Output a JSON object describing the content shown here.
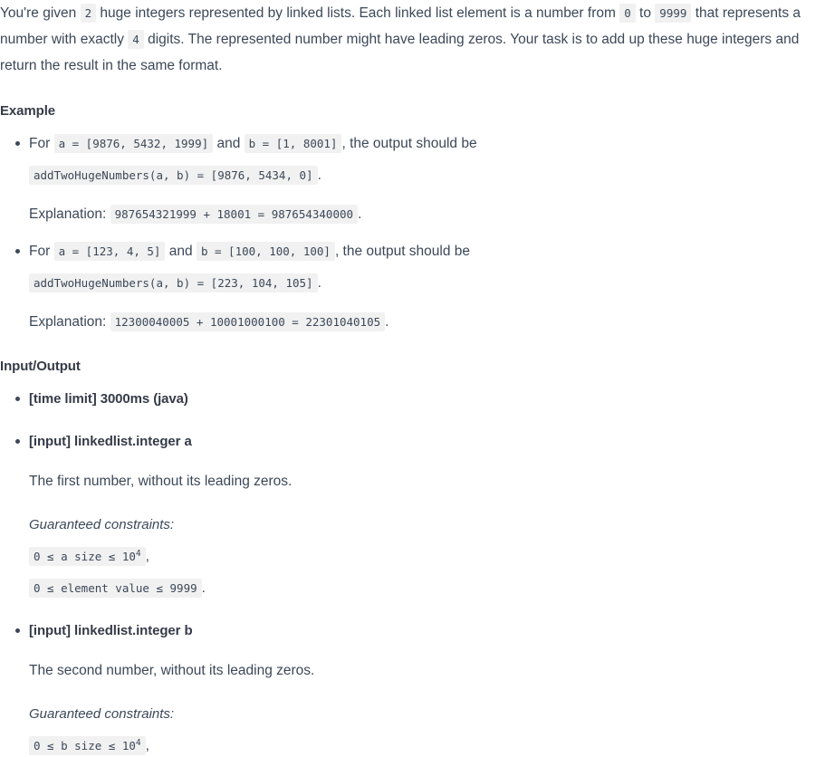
{
  "intro": {
    "part1": "You're given ",
    "count": "2",
    "part2": " huge integers represented by linked lists. Each linked list element is a number from ",
    "min": "0",
    "part3": " to ",
    "max": "9999",
    "part4": " that represents a number with exactly ",
    "digits": "4",
    "part5": " digits. The represented number might have leading zeros. Your task is to add up these huge integers and return the result in the same format."
  },
  "example_heading": "Example",
  "examples": [
    {
      "for_label": "For ",
      "a_code": "a = [9876, 5432, 1999]",
      "and_label": " and ",
      "b_code": "b = [1, 8001]",
      "output_label": ", the output should be",
      "result_code": "addTwoHugeNumbers(a, b) = [9876, 5434, 0]",
      "period": ".",
      "explanation_label": "Explanation: ",
      "explanation_code": "987654321999 + 18001 = 987654340000",
      "explanation_period": "."
    },
    {
      "for_label": "For ",
      "a_code": "a = [123, 4, 5]",
      "and_label": " and ",
      "b_code": "b = [100, 100, 100]",
      "output_label": ", the output should be",
      "result_code": "addTwoHugeNumbers(a, b) = [223, 104, 105]",
      "period": ".",
      "explanation_label": "Explanation: ",
      "explanation_code": "12300040005 + 10001000100 = 22301040105",
      "explanation_period": "."
    }
  ],
  "io_heading": "Input/Output",
  "io_items": [
    {
      "title": "[time limit] 3000ms (java)"
    },
    {
      "title": "[input] linkedlist.integer a",
      "description": "The first number, without its leading zeros.",
      "constraints_label": "Guaranteed constraints:",
      "constraints": [
        {
          "pre": "0 ≤ a size ≤ 10",
          "sup": "4",
          "sep": ","
        },
        {
          "pre": "0 ≤ element value ≤ 9999",
          "sup": "",
          "sep": "."
        }
      ]
    },
    {
      "title": "[input] linkedlist.integer b",
      "description": "The second number, without its leading zeros.",
      "constraints_label": "Guaranteed constraints:",
      "constraints": [
        {
          "pre": "0 ≤ b size ≤ 10",
          "sup": "4",
          "sep": ","
        }
      ]
    }
  ]
}
